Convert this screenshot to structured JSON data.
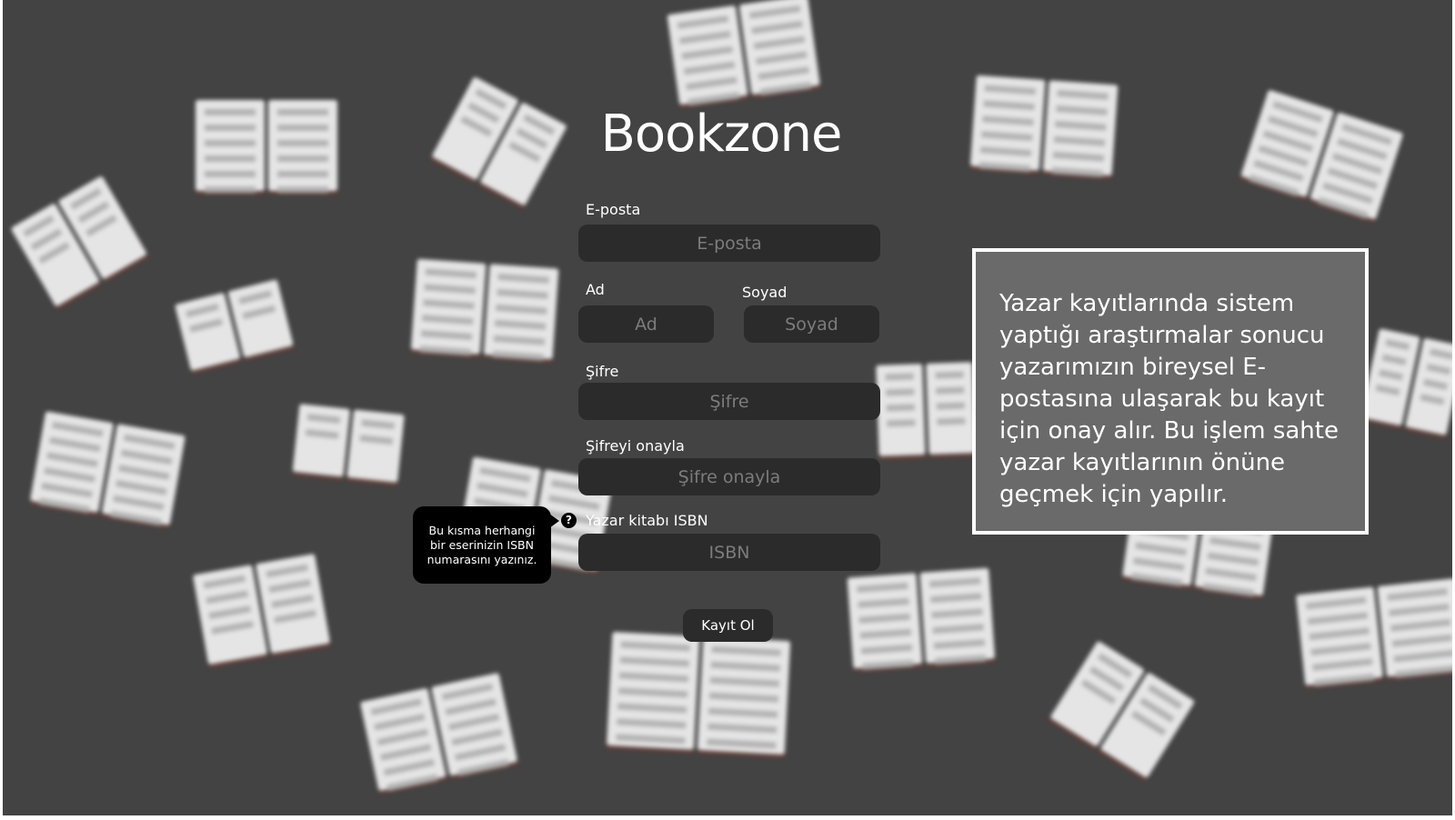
{
  "app": {
    "title": "Bookzone"
  },
  "form": {
    "email": {
      "label": "E-posta",
      "placeholder": "E-posta",
      "value": ""
    },
    "first_name": {
      "label": "Ad",
      "placeholder": "Ad",
      "value": ""
    },
    "last_name": {
      "label": "Soyad",
      "placeholder": "Soyad",
      "value": ""
    },
    "password": {
      "label": "Şifre",
      "placeholder": "Şifre",
      "value": ""
    },
    "password_confirm": {
      "label": "Şifreyi onayla",
      "placeholder": "Şifre onayla",
      "value": ""
    },
    "isbn": {
      "label": "Yazar kitabı ISBN",
      "placeholder": "ISBN",
      "value": ""
    },
    "submit_label": "Kayıt Ol"
  },
  "help": {
    "icon": "question-icon",
    "icon_glyph": "?",
    "tooltip": "Bu kısma herhangi bir eserinizin ISBN numarasını yazınız."
  },
  "info": {
    "text": "Yazar kayıtlarında sistem yaptığı araştırmalar sonucu yazarımızın bireysel E-postasına ulaşarak bu kayıt için onay alır. Bu işlem sahte yazar kayıtlarının önüne geçmek için yapılır."
  },
  "colors": {
    "background": "#434343",
    "field": "#2b2b2b",
    "info_box": "#6a6a6a",
    "tooltip": "#000000"
  }
}
